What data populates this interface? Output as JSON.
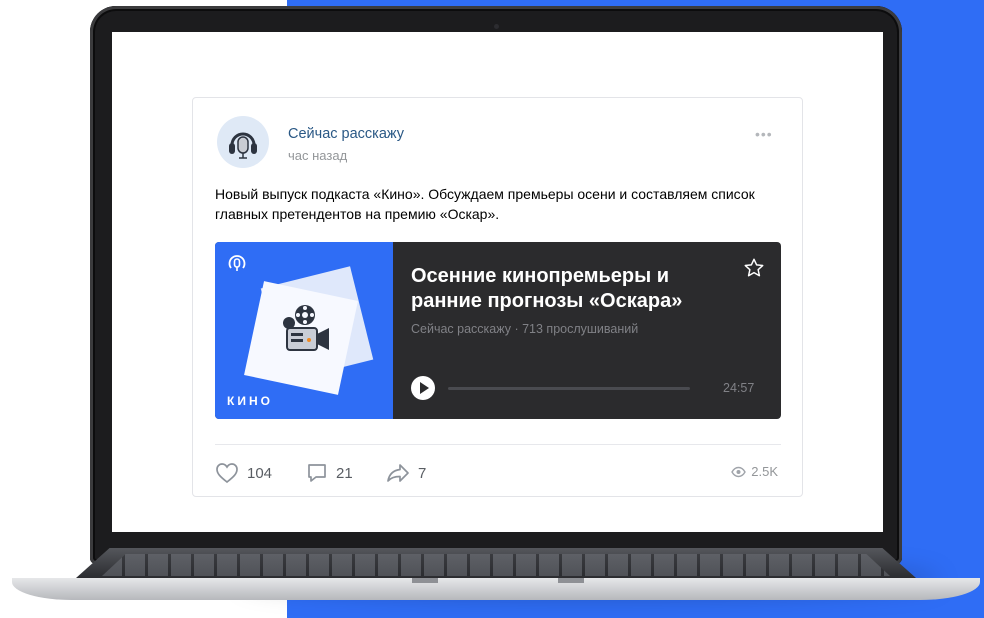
{
  "colors": {
    "brand_blue": "#2f6df5",
    "link": "#2a5885",
    "player_bg": "#2b2b2d"
  },
  "post": {
    "author": "Сейчас расскажу",
    "time": "час назад",
    "more_icon": "•••",
    "text": "Новый выпуск подкаста «Кино». Обсуждаем премьеры осени и составляем список главных претендентов на премию «Оскар».",
    "avatar_icon": "headphones-microphone-icon"
  },
  "podcast": {
    "cover_label": "КИНО",
    "title": "Осенние кинопремьеры и ранние прогнозы «Оскара»",
    "meta": "Сейчас расскажу · 713 прослушиваний",
    "duration": "24:57",
    "progress": 0,
    "icons": {
      "logo": "podcast-logo-icon",
      "cover": "film-camera-icon",
      "favorite": "star-icon",
      "play": "play-icon"
    }
  },
  "actions": {
    "likes": "104",
    "comments": "21",
    "shares": "7",
    "views": "2.5K",
    "icons": {
      "like": "heart-icon",
      "comment": "comment-icon",
      "share": "share-icon",
      "views": "eye-icon"
    }
  }
}
